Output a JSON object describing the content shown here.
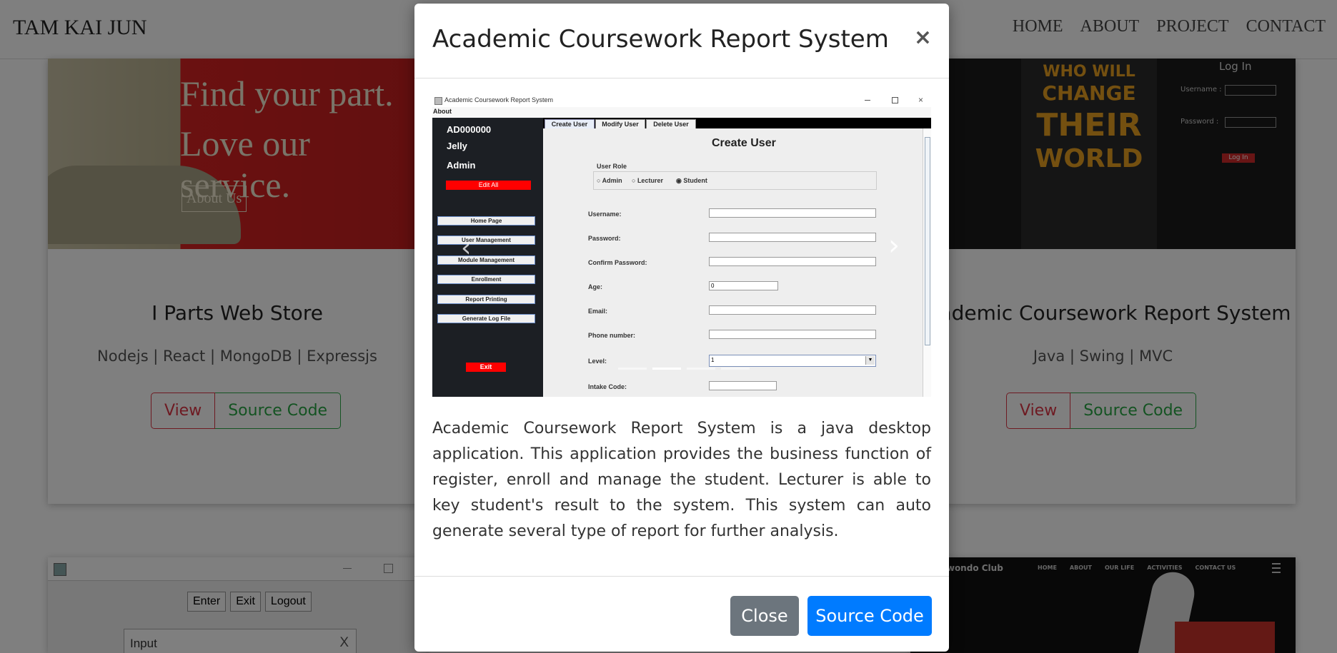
{
  "navbar": {
    "brand": "TAM KAI JUN",
    "links": [
      "HOME",
      "ABOUT",
      "PROJECT",
      "CONTACT"
    ]
  },
  "cards": [
    {
      "banner_line1": "Find your part.",
      "banner_line2": "Love our service.",
      "banner_button": "About Us",
      "title": "I Parts Web Store",
      "tags": "Nodejs | React | MongoDB | Expressjs",
      "view_label": "View",
      "source_label": "Source Code"
    },
    {
      "banner_text1": "WHO WILL",
      "banner_text2": "CHANGE",
      "banner_text3": "THEIR",
      "banner_text4": "WORLD",
      "login_title": "Log In",
      "login_username": "Username :",
      "login_password": "Password :",
      "login_button": "Log In",
      "title": "Academic Coursework Report System",
      "tags": "Java | Swing | MVC",
      "view_label": "View",
      "source_label": "Source Code"
    }
  ],
  "bottom_cards": {
    "left_buttons": [
      "Enter",
      "Exit",
      "Logout"
    ],
    "left_dialog_title": "Input",
    "left_dialog_close": "X",
    "right_title": "Taekwondo Club",
    "right_nav": [
      "HOME",
      "ABOUT",
      "OUR LIFE",
      "ACTIVITIES",
      "CONTACT US"
    ]
  },
  "modal": {
    "title": "Academic Coursework Report System",
    "close_glyph": "×",
    "description": "Academic Coursework Report System is a java desktop application. This application provides the business function of register, enroll and manage the student. Lecturer is able to key student's result to the system. This system can auto generate several type of report for further analysis.",
    "close_button": "Close",
    "source_button": "Source Code",
    "screenshot": {
      "window_title": "Academic Coursework Report System",
      "menu": "About",
      "user_id": "AD000000",
      "user_name": "Jelly",
      "user_role": "Admin",
      "edit_all": "Edit All",
      "sidebar": [
        "Home Page",
        "User Management",
        "Module Management",
        "Enrollment",
        "Report Printing",
        "Generate Log File"
      ],
      "exit": "Exit",
      "tabs": [
        "Create User",
        "Modify User",
        "Delete User"
      ],
      "form_title": "Create User",
      "role_label": "User Role",
      "roles": [
        "Admin",
        "Lecturer",
        "Student"
      ],
      "fields": [
        "Username:",
        "Password:",
        "Confirm Password:",
        "Age:",
        "Email:",
        "Phone number:",
        "Level:",
        "Intake Code:"
      ],
      "age_value": "0",
      "level_value": "1"
    }
  },
  "colors": {
    "view": "#dc3545",
    "source": "#28a745",
    "primary": "#007bff",
    "secondary": "#6c757d"
  }
}
